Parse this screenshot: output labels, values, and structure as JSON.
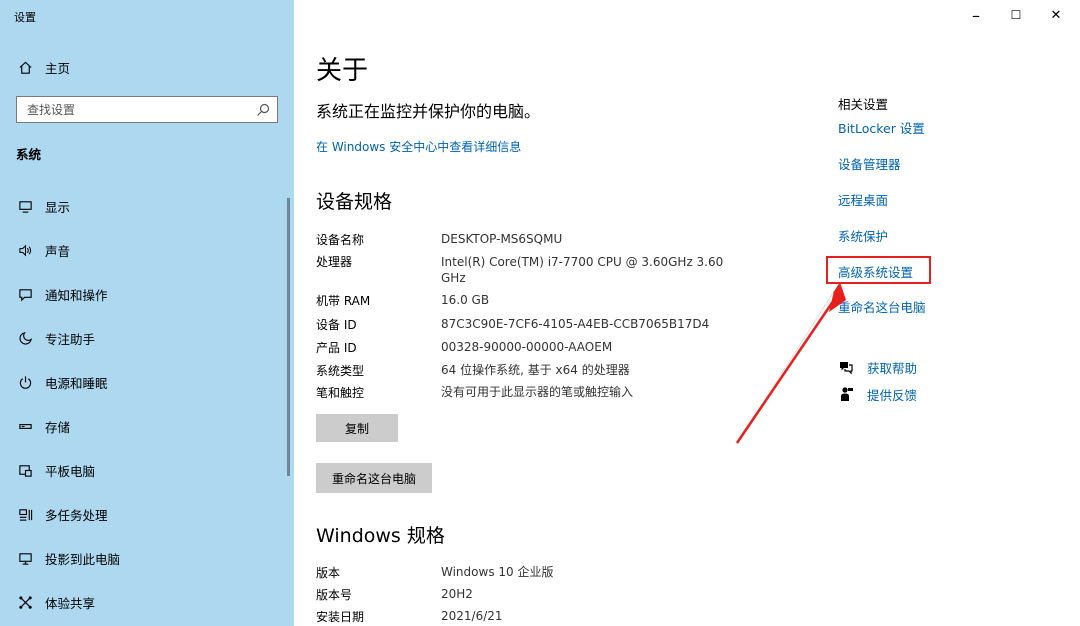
{
  "app": {
    "title": "设置"
  },
  "window_controls": {
    "minimize": "–",
    "maximize": "☐",
    "close": "✕"
  },
  "sidebar": {
    "home": "主页",
    "search_placeholder": "查找设置",
    "section": "系统",
    "items": [
      {
        "label": "显示",
        "icon": "display-icon"
      },
      {
        "label": "声音",
        "icon": "sound-icon"
      },
      {
        "label": "通知和操作",
        "icon": "notification-icon"
      },
      {
        "label": "专注助手",
        "icon": "focus-assist-icon"
      },
      {
        "label": "电源和睡眠",
        "icon": "power-icon"
      },
      {
        "label": "存储",
        "icon": "storage-icon"
      },
      {
        "label": "平板电脑",
        "icon": "tablet-icon"
      },
      {
        "label": "多任务处理",
        "icon": "multitasking-icon"
      },
      {
        "label": "投影到此电脑",
        "icon": "projecting-icon"
      },
      {
        "label": "体验共享",
        "icon": "shared-experiences-icon"
      }
    ]
  },
  "main": {
    "title": "关于",
    "status": "系统正在监控并保护你的电脑。",
    "security_link": "在 Windows 安全中心中查看详细信息",
    "device_specs": {
      "heading": "设备规格",
      "rows": [
        {
          "key": "设备名称",
          "value": "DESKTOP-MS6SQMU"
        },
        {
          "key": "处理器",
          "value": "Intel(R) Core(TM) i7-7700 CPU @ 3.60GHz   3.60 GHz"
        },
        {
          "key": "机带 RAM",
          "value": "16.0 GB"
        },
        {
          "key": "设备 ID",
          "value": "87C3C90E-7CF6-4105-A4EB-CCB7065B17D4"
        },
        {
          "key": "产品 ID",
          "value": "00328-90000-00000-AAOEM"
        },
        {
          "key": "系统类型",
          "value": "64 位操作系统, 基于 x64 的处理器"
        },
        {
          "key": "笔和触控",
          "value": "没有可用于此显示器的笔或触控输入"
        }
      ],
      "copy_button": "复制",
      "rename_button": "重命名这台电脑"
    },
    "windows_specs": {
      "heading": "Windows 规格",
      "rows": [
        {
          "key": "版本",
          "value": "Windows 10 企业版"
        },
        {
          "key": "版本号",
          "value": "20H2"
        },
        {
          "key": "安装日期",
          "value": "2021/6/21"
        }
      ]
    }
  },
  "related": {
    "title": "相关设置",
    "links": [
      "BitLocker 设置",
      "设备管理器",
      "远程桌面",
      "系统保护",
      "高级系统设置",
      "重命名这台电脑"
    ],
    "help": {
      "get_help": "获取帮助",
      "feedback": "提供反馈"
    }
  },
  "colors": {
    "sidebar_bg": "#add8ef",
    "link": "#0063b1",
    "highlight": "#e8201d"
  }
}
